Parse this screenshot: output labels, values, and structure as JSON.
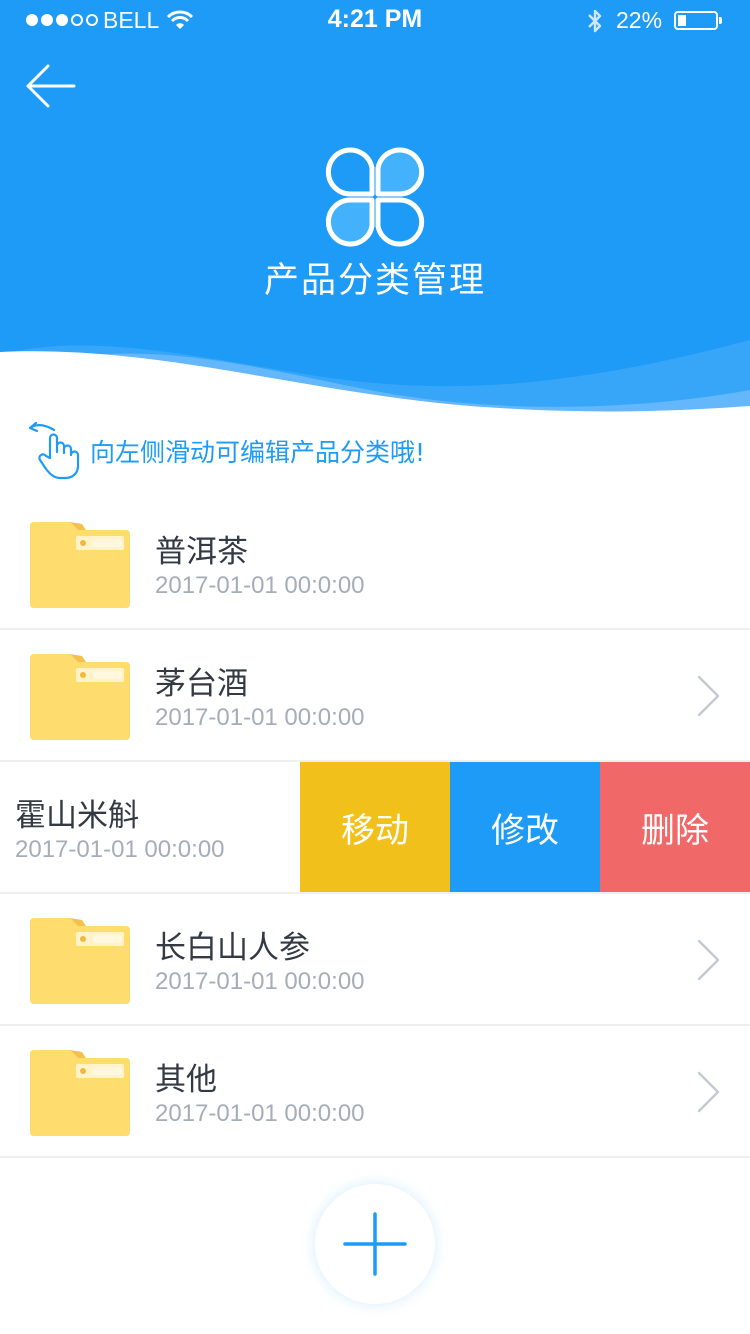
{
  "status_bar": {
    "carrier": "BELL",
    "time": "4:21 PM",
    "battery_percent": "22%",
    "battery_level": 0.22,
    "signal_bars": 3,
    "signal_total": 5
  },
  "header": {
    "title": "产品分类管理",
    "back_icon": "arrow-left-icon",
    "logo_icon": "four-leaf-logo-icon",
    "background_color": "#1e9bf7"
  },
  "hint": {
    "icon": "swipe-left-hand-icon",
    "text": "向左侧滑动可编辑产品分类哦!"
  },
  "categories": [
    {
      "name": "普洱茶",
      "date": "2017-01-01 00:0:00",
      "show_chevron": false
    },
    {
      "name": "茅台酒",
      "date": "2017-01-01 00:0:00",
      "show_chevron": true
    },
    {
      "name": "霍山米斛",
      "date": "2017-01-01 00:0:00",
      "swiped": true
    },
    {
      "name": "长白山人参",
      "date": "2017-01-01 00:0:00",
      "show_chevron": true
    },
    {
      "name": "其他",
      "date": "2017-01-01 00:0:00",
      "show_chevron": true
    }
  ],
  "swipe_actions": {
    "move": "移动",
    "edit": "修改",
    "delete": "删除",
    "colors": {
      "move": "#f2c01a",
      "edit": "#1e9bf7",
      "delete": "#f06868"
    }
  },
  "add_button": {
    "icon": "plus-icon"
  }
}
